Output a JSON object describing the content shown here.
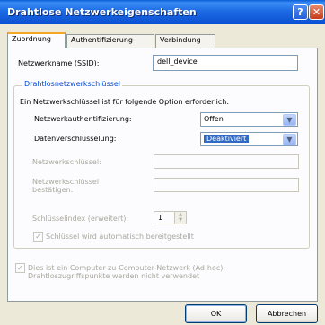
{
  "window": {
    "title": "Drahtlose Netzwerkeigenschaften",
    "help_glyph": "?",
    "close_glyph": "✕"
  },
  "tabs": [
    {
      "label": "Zuordnung",
      "active": true
    },
    {
      "label": "Authentifizierung",
      "active": false
    },
    {
      "label": "Verbindung",
      "active": false
    }
  ],
  "ssid": {
    "label": "Netzwerkname (SSID):",
    "value": "dell_device"
  },
  "group": {
    "legend": "Drahtlosnetzwerkschlüssel",
    "description": "Ein Netzwerkschlüssel ist für folgende Option erforderlich:",
    "auth_label": "Netzwerkauthentifizierung:",
    "auth_value": "Offen",
    "enc_label": "Datenverschlüsselung:",
    "enc_value": "Deaktiviert",
    "key_label": "Netzwerkschlüssel:",
    "confirm_label_1": "Netzwerkschlüssel",
    "confirm_label_2": "bestätigen:",
    "index_label": "Schlüsselindex (erweitert):",
    "index_value": "1",
    "auto_key_label": "Schlüssel wird automatisch bereitgestellt",
    "check_glyph": "✓"
  },
  "adhoc": {
    "line1": "Dies ist ein Computer-zu-Computer-Netzwerk (Ad-hoc);",
    "line2": "Drahtloszugriffspunkte werden nicht verwendet"
  },
  "buttons": {
    "ok": "OK",
    "cancel": "Abbrechen"
  },
  "colors": {
    "accent": "#316ac5",
    "title_bar": "#0b4fd1",
    "legend_text": "#0046d5",
    "disabled_text": "#a9a89e"
  }
}
